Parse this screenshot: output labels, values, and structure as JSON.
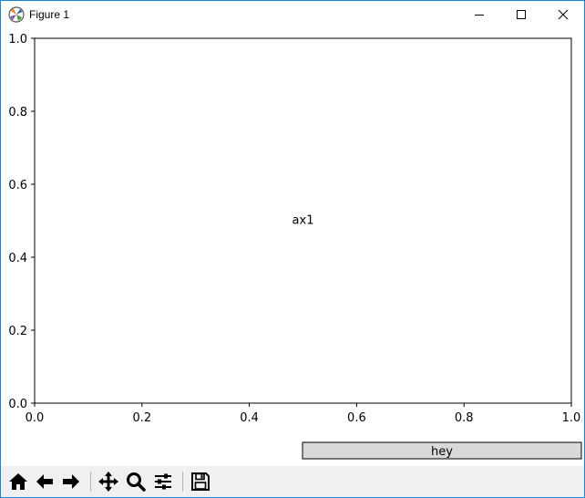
{
  "window": {
    "title": "Figure 1"
  },
  "chart_data": {
    "type": "scatter",
    "title": "",
    "xlabel": "",
    "ylabel": "",
    "xlim": [
      0.0,
      1.0
    ],
    "ylim": [
      0.0,
      1.0
    ],
    "grid": false,
    "x_ticks": [
      "0.0",
      "0.2",
      "0.4",
      "0.6",
      "0.8",
      "1.0"
    ],
    "y_ticks": [
      "0.0",
      "0.2",
      "0.4",
      "0.6",
      "0.8",
      "1.0"
    ],
    "annotations": [
      {
        "text": "ax1",
        "x": 0.5,
        "y": 0.5
      }
    ]
  },
  "widget_button": {
    "label": "hey"
  },
  "toolbar": {
    "items": [
      {
        "name": "home-icon"
      },
      {
        "name": "back-arrow-icon"
      },
      {
        "name": "forward-arrow-icon"
      },
      {
        "name": "pan-icon"
      },
      {
        "name": "zoom-icon"
      },
      {
        "name": "configure-subplots-icon"
      },
      {
        "name": "save-icon"
      }
    ]
  },
  "colors": {
    "window_border": "#1883d7",
    "toolbar_bg": "#f0f0f0",
    "widget_button_bg": "#d9d9d9"
  }
}
